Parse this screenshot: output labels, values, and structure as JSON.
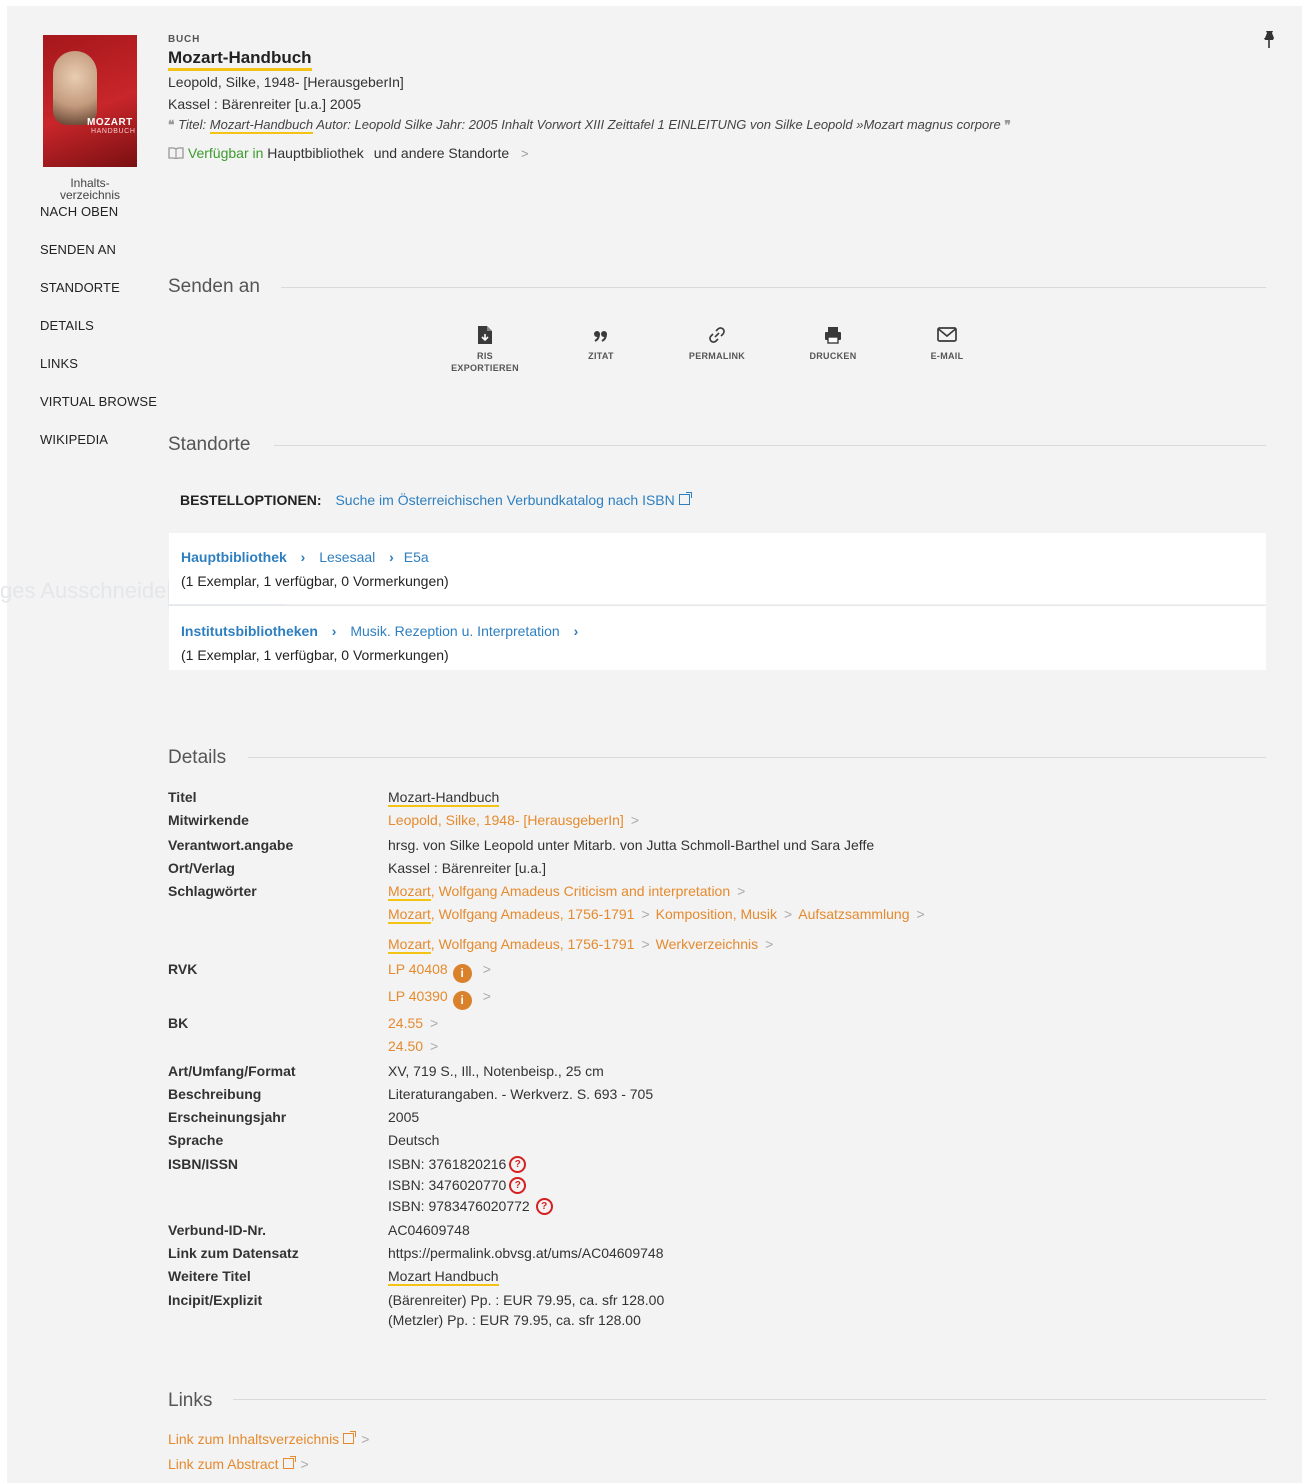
{
  "record": {
    "type": "BUCH",
    "title": "Mozart-Handbuch",
    "author": "Leopold, Silke, 1948- [HerausgeberIn]",
    "publisher": "Kassel : Bärenreiter [u.a.] 2005",
    "snippet_prefix": "Titel: ",
    "snippet_highlight": "Mozart-Handbuch",
    "snippet_rest": " Autor: Leopold Silke Jahr: 2005 Inhalt Vorwort XIII Zeittafel 1 EINLEITUNG von Silke Leopold »Mozart magnus corpore",
    "availability_label": "Verfügbar in",
    "availability_location": "Hauptbibliothek",
    "availability_other": "und andere Standorte"
  },
  "cover": {
    "title_line": "MOZART",
    "subtitle_line": "HANDBUCH",
    "toc_label_1": "Inhalts-",
    "toc_label_2": "verzeichnis"
  },
  "nav": {
    "items": [
      "NACH OBEN",
      "SENDEN AN",
      "STANDORTE",
      "DETAILS",
      "LINKS",
      "VIRTUAL BROWSE",
      "WIKIPEDIA"
    ]
  },
  "ghost_text": "ges Ausschneiden",
  "senden": {
    "heading": "Senden an",
    "actions": [
      {
        "label1": "RIS",
        "label2": "EXPORTIEREN",
        "icon": "file-export-icon"
      },
      {
        "label1": "ZITAT",
        "label2": "",
        "icon": "quote-icon"
      },
      {
        "label1": "PERMALINK",
        "label2": "",
        "icon": "link-icon"
      },
      {
        "label1": "DRUCKEN",
        "label2": "",
        "icon": "print-icon"
      },
      {
        "label1": "E-MAIL",
        "label2": "",
        "icon": "mail-icon"
      }
    ]
  },
  "standorte": {
    "heading": "Standorte",
    "bestell_label": "BESTELLOPTIONEN:",
    "bestell_link": "Suche im Österreichischen Verbundkatalog nach ISBN",
    "locations": [
      {
        "library": "Hauptbibliothek",
        "sub": "Lesesaal",
        "shelf": "E5a",
        "status": "(1 Exemplar, 1 verfügbar, 0 Vormerkungen)"
      },
      {
        "library": "Institutsbibliotheken",
        "sub": "Musik. Rezeption u. Interpretation",
        "shelf": "",
        "status": "(1 Exemplar, 1 verfügbar, 0 Vormerkungen)"
      }
    ]
  },
  "details": {
    "heading": "Details",
    "titel_label": "Titel",
    "titel": "Mozart-Handbuch",
    "mitwirkende_label": "Mitwirkende",
    "mitwirkende": "Leopold, Silke, 1948- [HerausgeberIn]",
    "verantwort_label": "Verantwort.angabe",
    "verantwort": "hrsg. von Silke Leopold unter Mitarb. von Jutta Schmoll-Barthel und Sara Jeffe",
    "ort_label": "Ort/Verlag",
    "ort": "Kassel : Bärenreiter [u.a.]",
    "schlag_label": "Schlagwörter",
    "schlag_1_a": "Mozart",
    "schlag_1_b": ", Wolfgang Amadeus Criticism and interpretation",
    "schlag_2_a": "Mozart",
    "schlag_2_b": ", Wolfgang Amadeus, 1756-1791",
    "schlag_2_c": "Komposition, Musik",
    "schlag_2_d": "Aufsatzsammlung",
    "schlag_3_a": "Mozart",
    "schlag_3_b": ", Wolfgang Amadeus, 1756-1791",
    "schlag_3_c": "Werkverzeichnis",
    "rvk_label": "RVK",
    "rvk_1": "LP 40408",
    "rvk_2": "LP 40390",
    "bk_label": "BK",
    "bk_1": "24.55",
    "bk_2": "24.50",
    "art_label": "Art/Umfang/Format",
    "art": "XV, 719 S., Ill., Notenbeisp., 25 cm",
    "beschreibung_label": "Beschreibung",
    "beschreibung": "Literaturangaben. - Werkverz. S. 693 - 705",
    "jahr_label": "Erscheinungsjahr",
    "jahr": "2005",
    "sprache_label": "Sprache",
    "sprache": "Deutsch",
    "isbn_label": "ISBN/ISSN",
    "isbn_1": "ISBN: 3761820216",
    "isbn_2": "ISBN: 3476020770",
    "isbn_3": "ISBN: 9783476020772",
    "verbund_label": "Verbund-ID-Nr.",
    "verbund": "AC04609748",
    "link_label": "Link zum Datensatz",
    "link": "https://permalink.obvsg.at/ums/AC04609748",
    "weitere_label": "Weitere Titel",
    "weitere": "Mozart Handbuch",
    "incipit_label": "Incipit/Explizit",
    "incipit_1": "(Bärenreiter) Pp. : EUR 79.95, ca. sfr 128.00",
    "incipit_2": "(Metzler) Pp. : EUR 79.95, ca. sfr 128.00"
  },
  "links": {
    "heading": "Links",
    "items": [
      "Link zum Inhaltsverzeichnis",
      "Link zum Abstract"
    ]
  },
  "glyphs": {
    "chevron": ">",
    "chevron_bold": "›",
    "info": "i",
    "oclc": "?",
    "quote_open": "❝",
    "quote_close": "❞"
  },
  "colors": {
    "accent_link": "#2e7fc0",
    "facet_orange": "#e58a2e",
    "available_green": "#3c9b2c",
    "highlight_yellow": "#f3c316",
    "panel_bg": "#f3f3f3"
  }
}
